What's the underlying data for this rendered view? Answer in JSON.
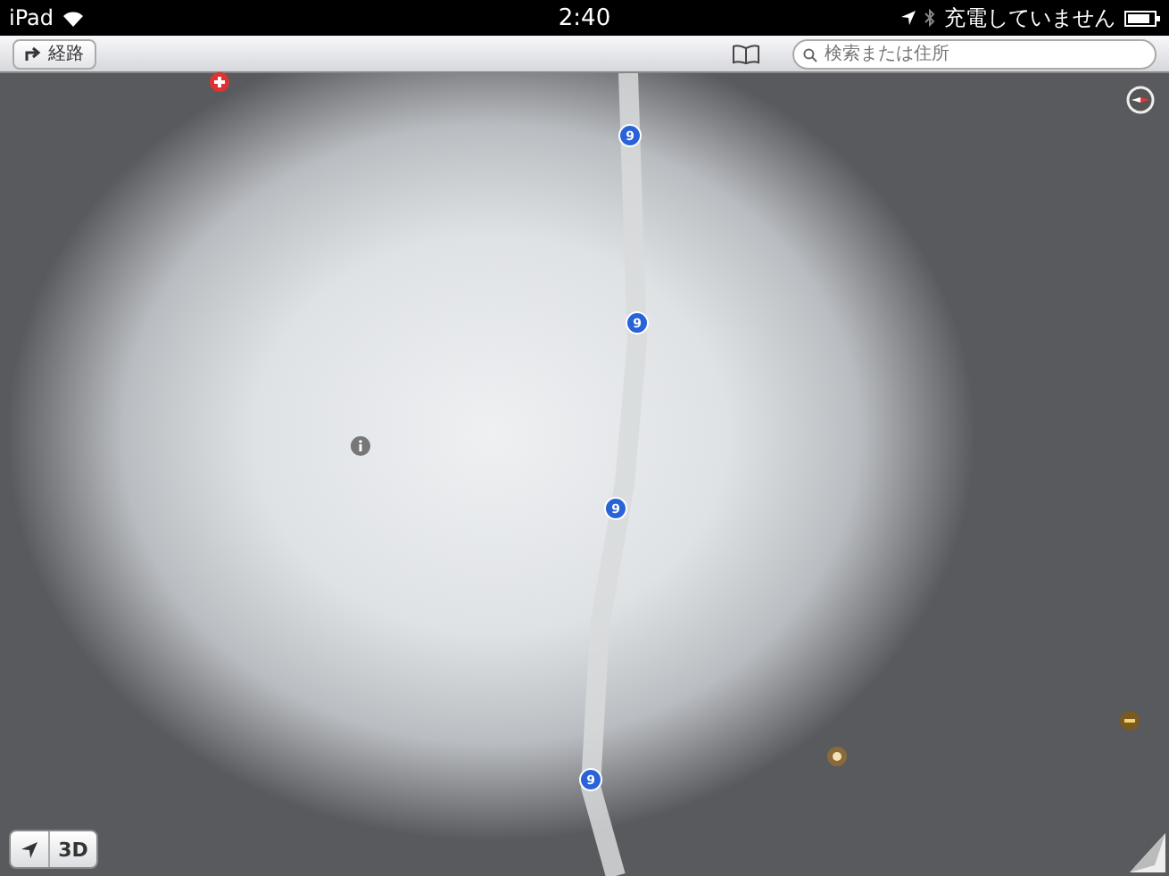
{
  "status_bar": {
    "device": "iPad",
    "time": "2:40",
    "charging": "充電していません"
  },
  "toolbar": {
    "directions_button": "経路",
    "search": {
      "placeholder": "検索または住所"
    }
  },
  "map": {
    "route_shields": [
      "9",
      "9",
      "9",
      "9"
    ]
  },
  "map_controls": {
    "three_d_button": "3D"
  }
}
